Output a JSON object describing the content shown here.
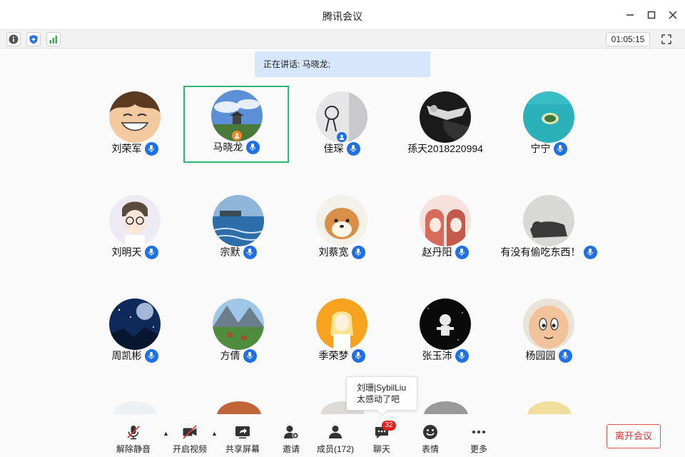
{
  "window": {
    "title": "腾讯会议"
  },
  "status": {
    "timer": "01:05:15"
  },
  "speaking": {
    "label": "正在讲话: 马晓龙;"
  },
  "participants": [
    {
      "name": "刘荣军",
      "mic": true,
      "theme": "cartoon-face"
    },
    {
      "name": "马晓龙",
      "mic": true,
      "theme": "pavilion",
      "active": true,
      "badge": "host"
    },
    {
      "name": "佳琛",
      "mic": true,
      "theme": "sketch",
      "badge": "cohost"
    },
    {
      "name": "孫天2018220994",
      "mic": false,
      "theme": "dark-photo"
    },
    {
      "name": "宁宁",
      "mic": true,
      "theme": "island"
    },
    {
      "name": "刘明天",
      "mic": true,
      "theme": "anime-glasses"
    },
    {
      "name": "宗默",
      "mic": true,
      "theme": "lake"
    },
    {
      "name": "刘蔡宽",
      "mic": true,
      "theme": "shiba"
    },
    {
      "name": "赵丹阳",
      "mic": true,
      "theme": "anime-girls"
    },
    {
      "name": "有没有偷吃东西！",
      "mic": true,
      "theme": "cat"
    },
    {
      "name": "周凯彬",
      "mic": true,
      "theme": "night-sky"
    },
    {
      "name": "方倩",
      "mic": true,
      "theme": "mountain-village"
    },
    {
      "name": "季荣梦",
      "mic": true,
      "theme": "yellow-girl"
    },
    {
      "name": "张玉沛",
      "mic": true,
      "theme": "astronaut"
    },
    {
      "name": "杨园园",
      "mic": true,
      "theme": "cartoon-kid"
    }
  ],
  "chat_tooltip": {
    "sender": "刘珊|SybilLiu",
    "message": "太感动了吧"
  },
  "toolbar": {
    "unmute": "解除静音",
    "start_video": "开启视频",
    "share_screen": "共享屏幕",
    "invite": "邀请",
    "members": "成员(172)",
    "chat": "聊天",
    "chat_count": "32",
    "reactions": "表情",
    "more": "更多",
    "leave": "离开会议"
  },
  "colors": {
    "accent": "#1f6fe5",
    "active_border": "#2eb872",
    "leave": "#d92e2e",
    "badge": "#e02020"
  }
}
